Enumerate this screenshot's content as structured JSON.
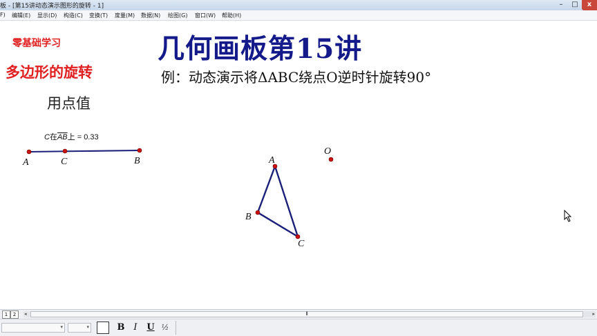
{
  "window": {
    "title": "板 - [第15讲动态演示图形的旋转 - 1]",
    "controls": {
      "minimize": "–",
      "maximize": "□",
      "close": "x"
    }
  },
  "menu": {
    "items": [
      {
        "label": "F)"
      },
      {
        "label": "编辑(E)"
      },
      {
        "label": "显示(D)"
      },
      {
        "label": "构造(C)"
      },
      {
        "label": "变换(T)"
      },
      {
        "label": "度量(M)"
      },
      {
        "label": "数据(N)"
      },
      {
        "label": "绘图(G)"
      },
      {
        "label": "窗口(W)"
      },
      {
        "label": "帮助(H)"
      }
    ]
  },
  "canvas": {
    "label_zero": "零基础学习",
    "label_polygon": "多边形的旋转",
    "label_usepoint": "用点值",
    "main_title": "几何画板第15讲",
    "subtitle": "例：动态演示将ΔABC绕点O逆时针旋转90°",
    "measure": {
      "point": "C",
      "prefix": "在",
      "segment": "AB",
      "suffix": "上 = ",
      "value": "0.33"
    },
    "segment_points": {
      "A": "A",
      "C": "C",
      "B": "B"
    },
    "triangle_points": {
      "A": "A",
      "B": "B",
      "C": "C",
      "O": "O"
    },
    "colors": {
      "line": "#1a1f7a",
      "point": "#cc1111",
      "title": "#141a8a",
      "red_text": "#e02020"
    }
  },
  "pagebar": {
    "tabs": [
      {
        "label": "1"
      },
      {
        "label": "2"
      }
    ],
    "scroll_grip": "⦀"
  },
  "textbar": {
    "bold": "B",
    "italic": "I",
    "underline": "U",
    "math_label": "½"
  }
}
